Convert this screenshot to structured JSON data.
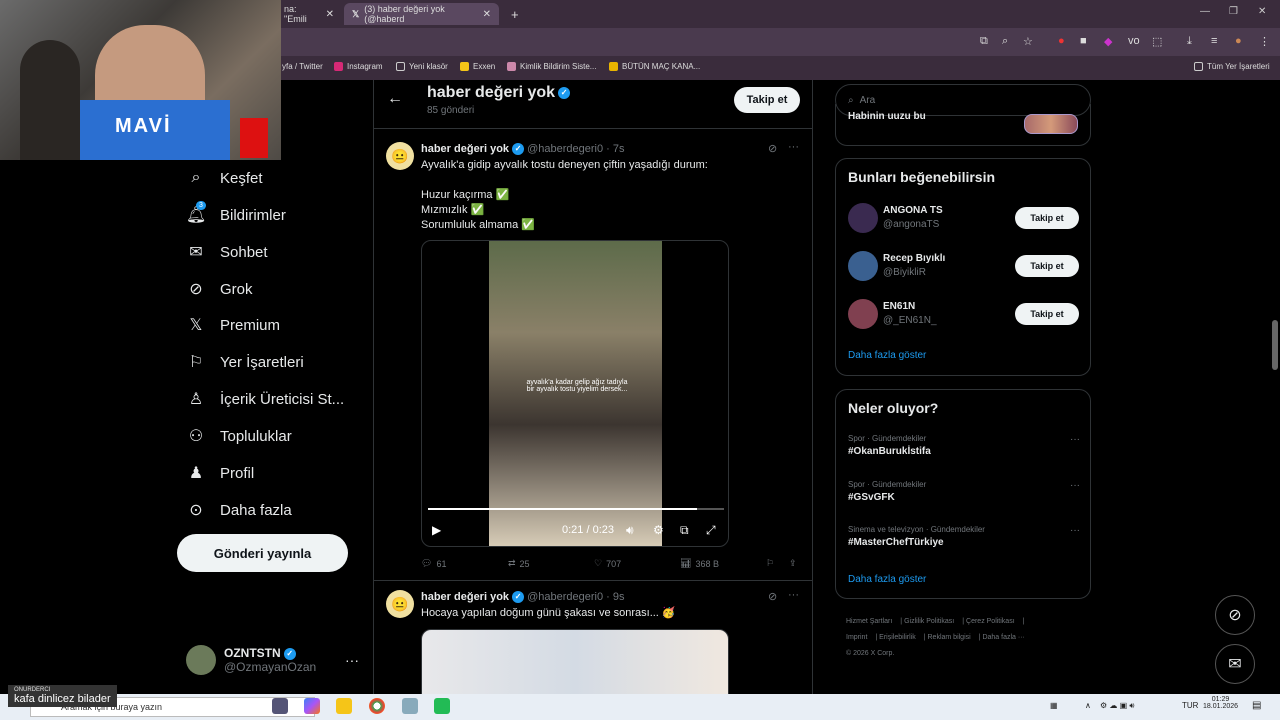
{
  "browser": {
    "tabs": [
      {
        "label": "na: \"Emili",
        "close": "✕"
      },
      {
        "label": "(3) haber değeri yok (@haberd",
        "close": "✕"
      }
    ],
    "new_tab": "+",
    "bookmarks": [
      {
        "label": "yfa / Twitter"
      },
      {
        "label": "Instagram"
      },
      {
        "label": "Yeni klasör"
      },
      {
        "label": "Exxen"
      },
      {
        "label": "Kimlik Bildirim Siste..."
      },
      {
        "label": "BÜTÜN MAÇ KANA..."
      }
    ],
    "all_bookmarks": "Tüm Yer İşaretleri"
  },
  "webcam": {
    "shirt_text": "MAVİ"
  },
  "nav": {
    "items": [
      {
        "label": "Keşfet",
        "icon": "search-icon"
      },
      {
        "label": "Bildirimler",
        "icon": "bell-icon",
        "badge": "3"
      },
      {
        "label": "Sohbet",
        "icon": "mail-icon"
      },
      {
        "label": "Grok",
        "icon": "grok-icon"
      },
      {
        "label": "Premium",
        "icon": "x-icon"
      },
      {
        "label": "Yer İşaretleri",
        "icon": "bookmark-icon"
      },
      {
        "label": "İçerik Üreticisi St...",
        "icon": "creator-icon"
      },
      {
        "label": "Topluluklar",
        "icon": "people-icon"
      },
      {
        "label": "Profil",
        "icon": "user-icon"
      },
      {
        "label": "Daha fazla",
        "icon": "more-icon"
      }
    ],
    "post_button": "Gönderi yayınla",
    "account": {
      "name": "OZNTSTN",
      "handle": "@OzmayanOzan"
    }
  },
  "profile_header": {
    "title": "haber değeri yok",
    "subtitle": "85 gönderi",
    "follow": "Takip et"
  },
  "tweets": [
    {
      "name": "haber değeri yok",
      "handle": "@haberdegeri0",
      "time": "· 7s",
      "text": "Ayvalık'a gidip ayvalık tostu deneyen çiftin yaşadığı durum:\n\nHuzur kaçırma ✅\nMızmızlık ✅\nSorumluluk almama ✅",
      "video_caption": "ayvalık'a kadar gelip ağız tadıyla bir ayvalık tostu yiyelim dersek...",
      "video_time": "0:21 / 0:23",
      "video_progress": 0.91,
      "replies": "61",
      "reposts": "25",
      "likes": "707",
      "views": "368 B"
    },
    {
      "name": "haber değeri yok",
      "handle": "@haberdegeri0",
      "time": "· 9s",
      "text": "Hocaya yapılan doğum günü şakası ve sonrası... 🥳"
    }
  ],
  "right": {
    "search_placeholder": "Ara",
    "top_card_text": "Habinin uuzu bu",
    "suggest_title": "Bunları beğenebilirsin",
    "suggestions": [
      {
        "name": "ANGONA TS",
        "handle": "@angonaTS",
        "follow": "Takip et"
      },
      {
        "name": "Recep Bıyıklı",
        "handle": "@BiyikliR",
        "follow": "Takip et"
      },
      {
        "name": "EN61N",
        "handle": "@_EN61N_",
        "follow": "Takip et"
      }
    ],
    "suggest_more": "Daha fazla göster",
    "trends_title": "Neler oluyor?",
    "trends": [
      {
        "category": "Spor · Gündemdekiler",
        "tag": "#OkanBurukİstifa"
      },
      {
        "category": "Spor · Gündemdekiler",
        "tag": "#GSvGFK"
      },
      {
        "category": "Sinema ve televizyon · Gündemdekiler",
        "tag": "#MasterChefTürkiye"
      }
    ],
    "trends_more": "Daha fazla göster",
    "footer": [
      "Hizmet Şartları",
      "Gizlilik Politikası",
      "Çerez Politikası",
      "Imprint",
      "Erişilebilirlik",
      "Reklam bilgisi",
      "Daha fazla ···",
      "© 2026 X Corp."
    ]
  },
  "taskbar": {
    "search": "Aramak için buraya yazın",
    "lang": "TUR",
    "time": "01:29",
    "date": "18.01.2026"
  },
  "overlay": {
    "small": "ONURDERCI",
    "text": "kafa dinlicez bilader"
  }
}
